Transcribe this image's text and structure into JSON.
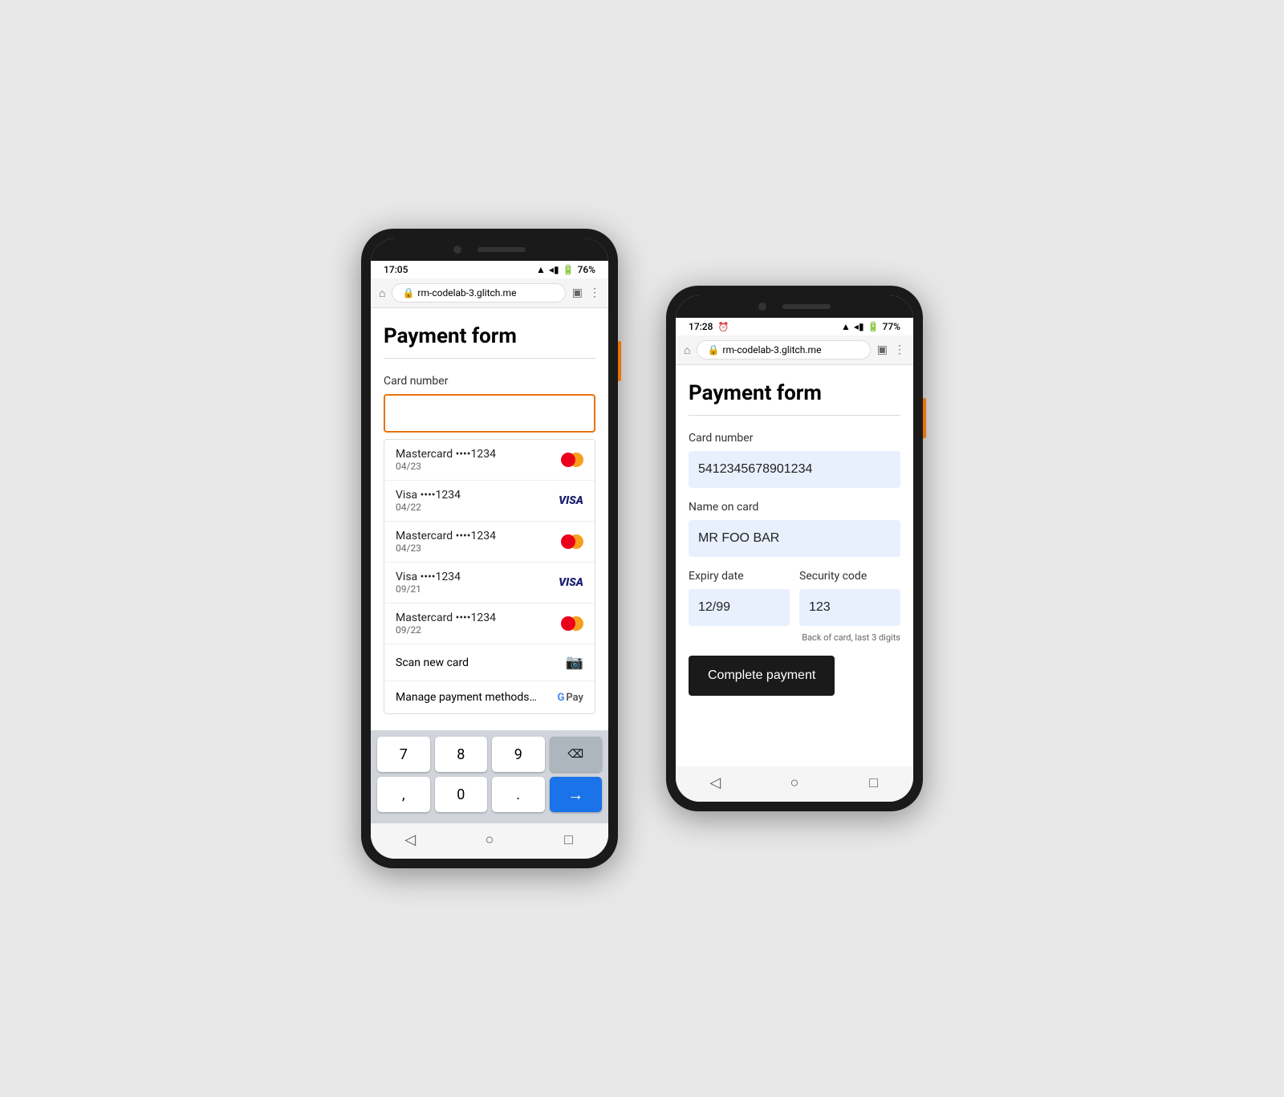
{
  "left_phone": {
    "status_time": "17:05",
    "battery": "76%",
    "url": "rm-codelab-3.glitch.me",
    "page_title": "Payment form",
    "card_number_label": "Card number",
    "card_number_placeholder": "",
    "suggestions": [
      {
        "brand": "Mastercard",
        "dots": "••••1234",
        "expiry": "04/23",
        "type": "mastercard"
      },
      {
        "brand": "Visa",
        "dots": "••••1234",
        "expiry": "04/22",
        "type": "visa"
      },
      {
        "brand": "Mastercard",
        "dots": "••••1234",
        "expiry": "04/23",
        "type": "mastercard"
      },
      {
        "brand": "Visa",
        "dots": "••••1234",
        "expiry": "09/21",
        "type": "visa"
      },
      {
        "brand": "Mastercard",
        "dots": "••••1234",
        "expiry": "09/22",
        "type": "mastercard"
      }
    ],
    "scan_label": "Scan new card",
    "manage_label": "Manage payment methods…",
    "keys": [
      [
        "7",
        "8",
        "9",
        "⌫"
      ],
      [
        ",",
        "0",
        ".",
        "→"
      ]
    ]
  },
  "right_phone": {
    "status_time": "17:28",
    "battery": "77%",
    "url": "rm-codelab-3.glitch.me",
    "page_title": "Payment form",
    "card_number_label": "Card number",
    "card_number_value": "5412345678901234",
    "name_label": "Name on card",
    "name_value": "MR FOO BAR",
    "expiry_label": "Expiry date",
    "expiry_value": "12/99",
    "security_label": "Security code",
    "security_value": "123",
    "security_hint": "Back of card, last 3 digits",
    "submit_label": "Complete payment"
  },
  "colors": {
    "orange_border": "#e8720c",
    "blue_input": "#e8f0fe",
    "dark_button": "#1a1a1a",
    "visa_blue": "#1a1f71",
    "mc_red": "#eb001b",
    "mc_yellow": "#f79e1b"
  }
}
